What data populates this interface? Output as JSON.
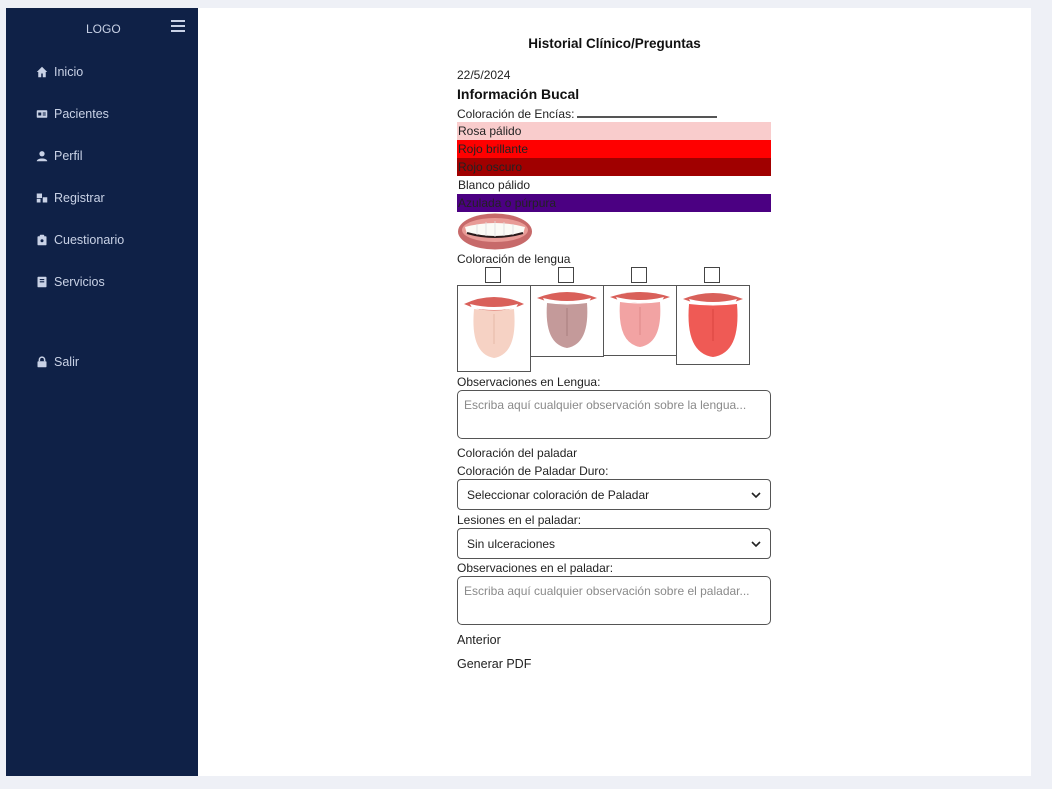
{
  "sidebar": {
    "logo": "LOGO",
    "items": [
      {
        "label": "Inicio",
        "icon": "home-icon"
      },
      {
        "label": "Pacientes",
        "icon": "id-card-icon"
      },
      {
        "label": "Perfil",
        "icon": "user-icon"
      },
      {
        "label": "Registrar",
        "icon": "register-icon"
      },
      {
        "label": "Cuestionario",
        "icon": "clipboard-icon"
      },
      {
        "label": "Servicios",
        "icon": "book-icon"
      }
    ],
    "logout": {
      "label": "Salir",
      "icon": "lock-icon"
    },
    "colors": {
      "background": "#0f2147",
      "text": "#c9d2e6"
    }
  },
  "main": {
    "title": "Historial Clínico/Preguntas",
    "date": "22/5/2024",
    "section_title": "Información Bucal",
    "gum_color_label": "Coloración de Encías:",
    "gum_options": [
      {
        "label": "Rosa pálido",
        "color": "#f9cccc"
      },
      {
        "label": "Rojo brillante",
        "color": "#ff0000"
      },
      {
        "label": "Rojo oscuro",
        "color": "#a00000"
      },
      {
        "label": "Blanco pálido",
        "color": "#ffffff"
      },
      {
        "label": "Azulada o púrpura",
        "color": "#4b0082"
      }
    ],
    "tongue_label": "Coloración de lengua",
    "tongue_options": [
      {
        "name": "pale-tongue",
        "color": "#f6d2c4"
      },
      {
        "name": "gray-tongue",
        "color": "#c49a9a"
      },
      {
        "name": "pink-tongue",
        "color": "#f2a3a3"
      },
      {
        "name": "red-tongue",
        "color": "#ef5a55"
      }
    ],
    "tongue_obs_label": "Observaciones en Lengua:",
    "tongue_obs_placeholder": "Escriba aquí cualquier observación sobre la lengua...",
    "palate_label": "Coloración del paladar",
    "hard_palate_label": "Coloración de Paladar Duro:",
    "hard_palate_value": "Seleccionar coloración de Paladar",
    "lesions_label": "Lesiones en el paladar:",
    "lesions_value": "Sin ulceraciones",
    "palate_obs_label": "Observaciones en el paladar:",
    "palate_obs_placeholder": "Escriba aquí cualquier observación sobre el paladar...",
    "prev_label": "Anterior",
    "pdf_label": "Generar PDF"
  }
}
